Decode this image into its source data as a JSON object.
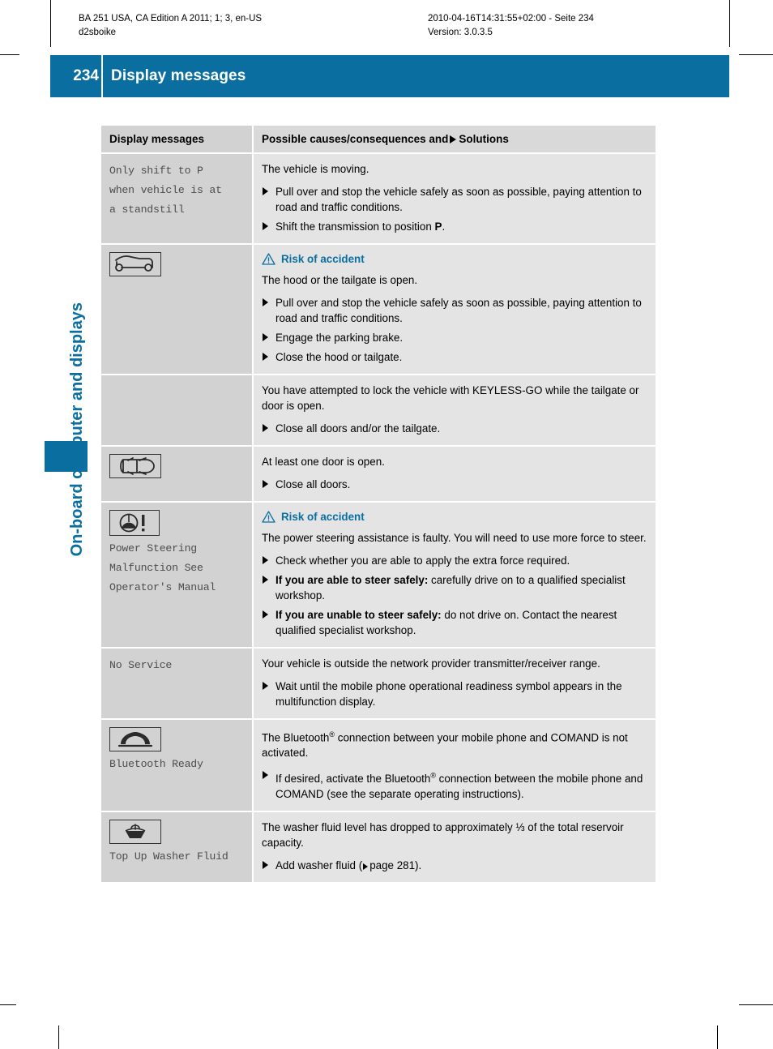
{
  "print_slug": {
    "left_line1": "BA 251 USA, CA Edition A 2011; 1; 3, en-US",
    "left_line2": "d2sboike",
    "right_line1": "2010-04-16T14:31:55+02:00 - Seite 234",
    "right_line2": "Version: 3.0.3.5"
  },
  "header": {
    "page_number": "234",
    "title": "Display messages",
    "accent_color": "#0a6fa0"
  },
  "chapter": {
    "label": "On-board computer and displays"
  },
  "table": {
    "columns": {
      "left": "Display messages",
      "right_pre": "Possible causes/consequences and",
      "right_post": "Solutions"
    },
    "rows": [
      {
        "message": "Only shift to P\nwhen vehicle is at\na standstill",
        "icon": null,
        "blocks": [
          {
            "cause": "The vehicle is moving.",
            "solutions": [
              "Pull over and stop the vehicle safely as soon as possible, paying attention to road and traffic conditions.",
              "Shift the transmission to position P."
            ]
          }
        ]
      },
      {
        "message": "",
        "icon": "hood-tailgate-open-icon",
        "blocks": [
          {
            "warning": "Risk of accident",
            "cause": "The hood or the tailgate is open.",
            "solutions": [
              "Pull over and stop the vehicle safely as soon as possible, paying attention to road and traffic conditions.",
              "Engage the parking brake.",
              "Close the hood or tailgate."
            ]
          },
          {
            "cause": "You have attempted to lock the vehicle with KEYLESS-GO while the tailgate or door is open.",
            "solutions": [
              "Close all doors and/or the tailgate."
            ]
          }
        ]
      },
      {
        "message": "",
        "icon": "door-open-icon",
        "blocks": [
          {
            "cause": "At least one door is open.",
            "solutions": [
              "Close all doors."
            ]
          }
        ]
      },
      {
        "message": "Power Steering\nMalfunction See\nOperator's Manual",
        "icon": "power-steering-warning-icon",
        "blocks": [
          {
            "warning": "Risk of accident",
            "cause": "The power steering assistance is faulty. You will need to use more force to steer.",
            "solutions": [
              "Check whether you are able to apply the extra force required.",
              "If you are able to steer safely: carefully drive on to a qualified specialist workshop.",
              "If you are unable to steer safely: do not drive on. Contact the nearest qualified specialist workshop."
            ]
          }
        ]
      },
      {
        "message": "No Service",
        "icon": null,
        "blocks": [
          {
            "cause": "Your vehicle is outside the network provider transmitter/receiver range.",
            "solutions": [
              "Wait until the mobile phone operational readiness symbol appears in the multifunction display."
            ]
          }
        ]
      },
      {
        "message": "Bluetooth Ready",
        "icon": "phone-handset-icon",
        "blocks": [
          {
            "cause": "The Bluetooth® connection between your mobile phone and COMAND is not activated.",
            "solutions": [
              "If desired, activate the Bluetooth® connection between the mobile phone and COMAND (see the separate operating instructions)."
            ]
          }
        ]
      },
      {
        "message": "Top Up Washer Fluid",
        "icon": "washer-fluid-icon",
        "blocks": [
          {
            "cause": "The washer fluid level has dropped to approximately ⅓ of the total reservoir capacity.",
            "solutions": [
              "Add washer fluid (page 281)."
            ],
            "page_ref": "page 281"
          }
        ]
      }
    ]
  }
}
